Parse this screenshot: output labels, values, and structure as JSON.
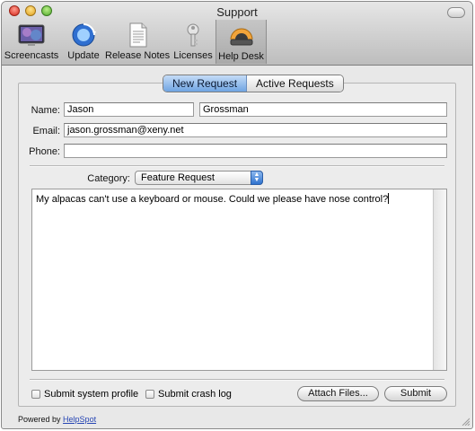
{
  "window": {
    "title": "Support"
  },
  "toolbar": {
    "items": [
      {
        "label": "Screencasts",
        "icon": "screencasts-icon"
      },
      {
        "label": "Update",
        "icon": "update-icon"
      },
      {
        "label": "Release Notes",
        "icon": "release-notes-icon"
      },
      {
        "label": "Licenses",
        "icon": "licenses-key-icon"
      },
      {
        "label": "Help Desk",
        "icon": "help-desk-icon",
        "selected": true
      }
    ]
  },
  "tabs": {
    "new_request": "New Request",
    "active_requests": "Active Requests",
    "selected": "New Request"
  },
  "form": {
    "name_label": "Name:",
    "first_name": "Jason",
    "last_name": "Grossman",
    "email_label": "Email:",
    "email": "jason.grossman@xeny.net",
    "phone_label": "Phone:",
    "phone": "",
    "category_label": "Category:",
    "category_value": "Feature Request",
    "message": "My alpacas can't use a keyboard or mouse.  Could we please have nose control?"
  },
  "options": {
    "submit_system_profile": "Submit system profile",
    "submit_crash_log": "Submit crash log"
  },
  "buttons": {
    "attach_files": "Attach Files...",
    "submit": "Submit"
  },
  "footer": {
    "powered_by": "Powered by",
    "link": "HelpSpot"
  },
  "colors": {
    "accent": "#6fa4e2",
    "link": "#2746b4"
  }
}
